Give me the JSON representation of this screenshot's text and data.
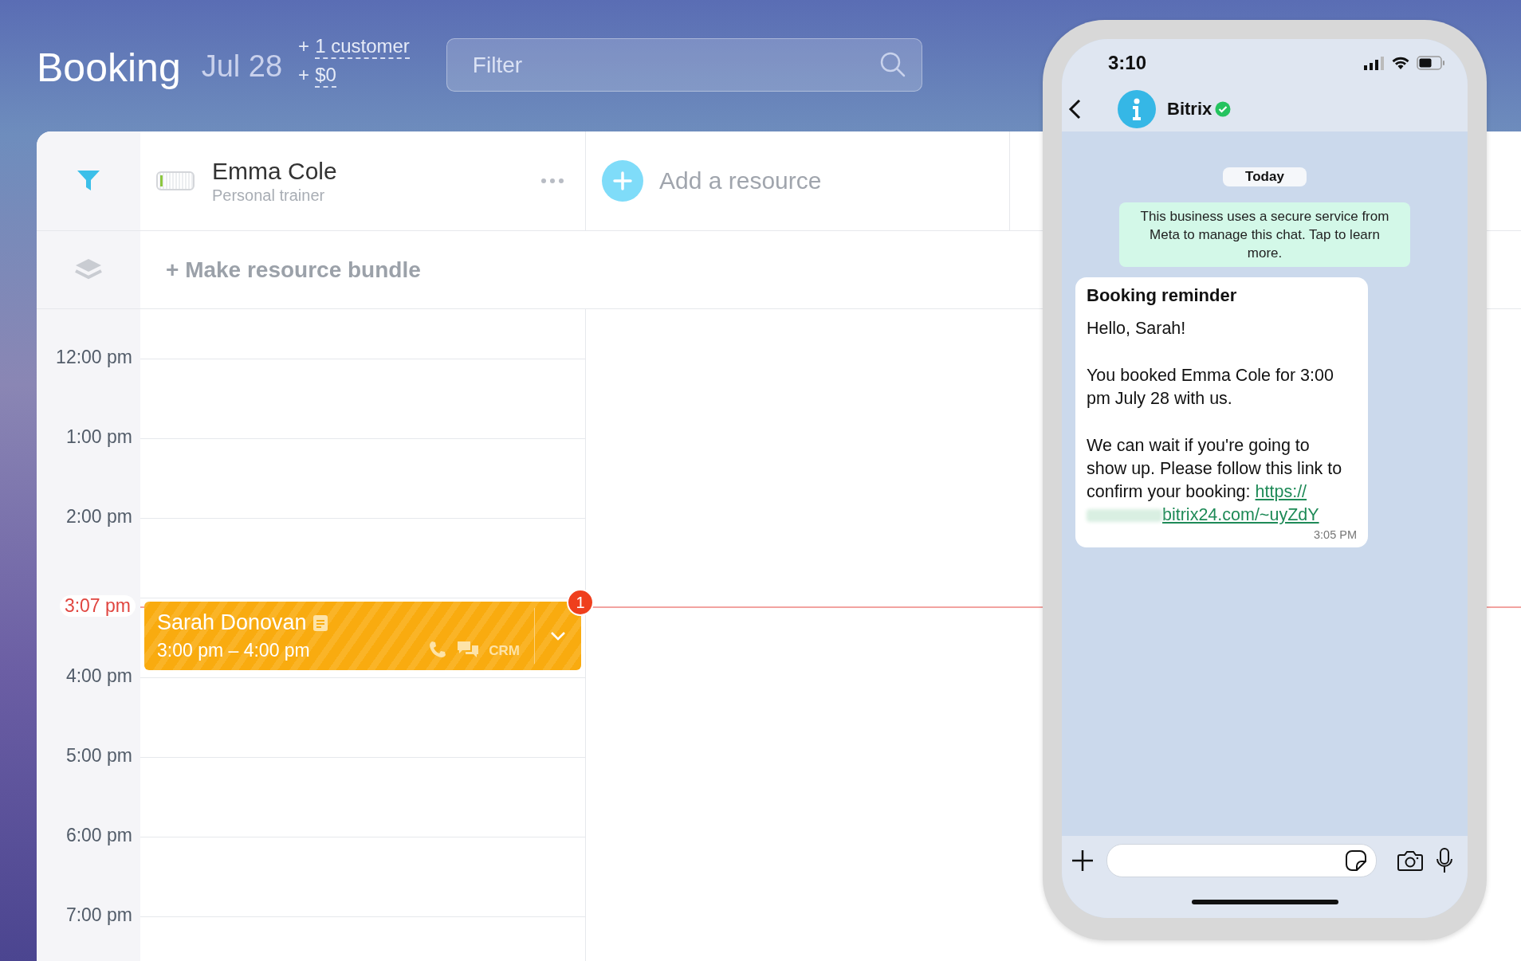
{
  "header": {
    "title": "Booking",
    "date": "Jul 28",
    "stats": [
      {
        "prefix": "+",
        "value": "1 customer"
      },
      {
        "prefix": "+",
        "value": "$0"
      }
    ],
    "filter": {
      "placeholder": "Filter"
    }
  },
  "resource": {
    "name": "Emma Cole",
    "role": "Personal trainer",
    "level": 0.06
  },
  "add_resource": {
    "label": "Add a resource"
  },
  "bundle": {
    "label": "+ Make resource bundle"
  },
  "timeline": [
    {
      "kind": "hour",
      "label": "12:00 pm"
    },
    {
      "kind": "hour",
      "label": "1:00 pm"
    },
    {
      "kind": "hour",
      "label": "2:00 pm"
    },
    {
      "kind": "now",
      "label": "3:07 pm"
    },
    {
      "kind": "hour",
      "label": "4:00 pm"
    },
    {
      "kind": "hour",
      "label": "5:00 pm"
    },
    {
      "kind": "hour",
      "label": "6:00 pm"
    },
    {
      "kind": "hour",
      "label": "7:00 pm"
    }
  ],
  "booking": {
    "client": "Sarah Donovan",
    "time": "3:00 pm – 4:00 pm",
    "has_note": true,
    "badge": "1",
    "crm": "CRM"
  },
  "phone": {
    "clock": "3:10",
    "contact": "Bitrix",
    "verified": true,
    "date_chip": "Today",
    "notice": "This business uses a secure service from Meta to manage this chat. Tap to learn more.",
    "message": {
      "title": "Booking reminder",
      "paragraphs": [
        "Hello, Sarah!",
        "You booked Emma Cole for 3:00 pm July 28 with us.",
        "We can wait if you're going to show up. Please follow this link to confirm your booking:"
      ],
      "link": [
        "https://",
        "bitrix24.com/~uyZdY"
      ],
      "time": "3:05 PM"
    }
  }
}
